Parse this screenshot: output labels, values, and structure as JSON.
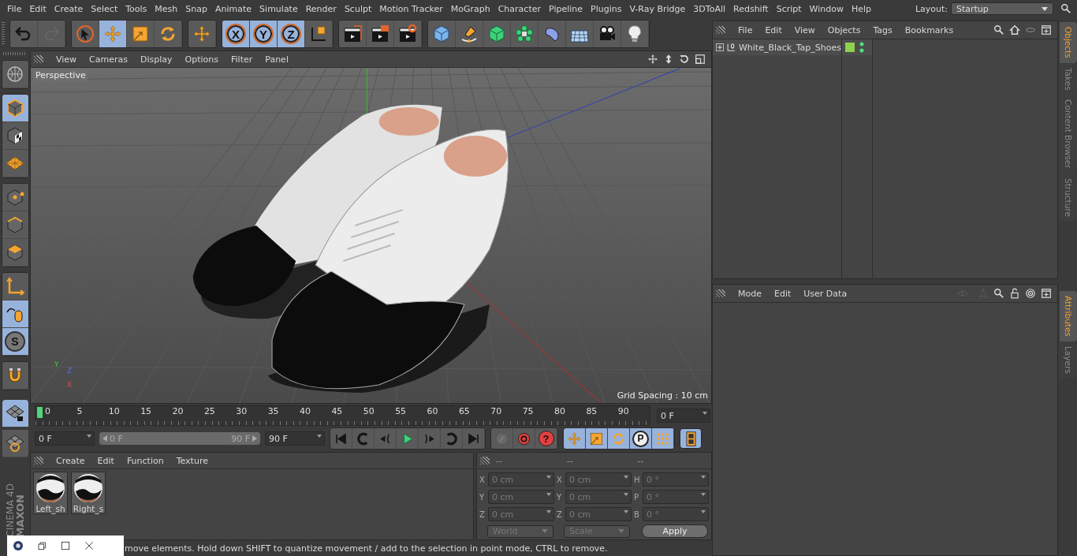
{
  "menu": [
    "File",
    "Edit",
    "Create",
    "Select",
    "Tools",
    "Mesh",
    "Snap",
    "Animate",
    "Simulate",
    "Render",
    "Sculpt",
    "Motion Tracker",
    "MoGraph",
    "Character",
    "Pipeline",
    "Plugins",
    "V-Ray Bridge",
    "3DToAll",
    "Redshift",
    "Script",
    "Window",
    "Help"
  ],
  "layout": {
    "label": "Layout:",
    "value": "Startup"
  },
  "toolbar": [
    {
      "buttons": [
        {
          "kind": "undo",
          "selected": false,
          "disabled": false
        },
        {
          "kind": "redo",
          "selected": false,
          "disabled": true
        }
      ]
    },
    {
      "buttons": [
        {
          "kind": "select",
          "selected": false,
          "disabled": false
        },
        {
          "kind": "move",
          "selected": true,
          "disabled": false
        },
        {
          "kind": "scale",
          "selected": false,
          "disabled": false
        },
        {
          "kind": "rotate",
          "selected": false,
          "disabled": false
        }
      ]
    },
    {
      "buttons": [
        {
          "kind": "move",
          "selected": false,
          "disabled": false
        }
      ]
    },
    {
      "buttons": [
        {
          "kind": "axis",
          "label": "X",
          "selected": true,
          "disabled": false
        },
        {
          "kind": "axis",
          "label": "Y",
          "selected": true,
          "disabled": false
        },
        {
          "kind": "axis",
          "label": "Z",
          "selected": true,
          "disabled": false
        },
        {
          "kind": "coords",
          "selected": false,
          "disabled": false
        }
      ]
    },
    {
      "buttons": [
        {
          "kind": "render-view",
          "selected": false,
          "disabled": false
        },
        {
          "kind": "render-pic",
          "selected": false,
          "disabled": false
        },
        {
          "kind": "render-settings",
          "selected": false,
          "disabled": false
        }
      ]
    },
    {
      "buttons": [
        {
          "kind": "cube",
          "selected": false,
          "disabled": false
        },
        {
          "kind": "pen",
          "selected": false,
          "disabled": false
        },
        {
          "kind": "subdiv",
          "selected": false,
          "disabled": false
        },
        {
          "kind": "cloner",
          "selected": false,
          "disabled": false
        },
        {
          "kind": "deformer",
          "selected": false,
          "disabled": false
        },
        {
          "kind": "floor",
          "selected": false,
          "disabled": false
        },
        {
          "kind": "camera",
          "selected": false,
          "disabled": false
        },
        {
          "kind": "light",
          "selected": false,
          "disabled": false
        }
      ]
    }
  ],
  "left_tools": [
    {
      "buttons": [
        {
          "kind": "globe",
          "selected": false
        }
      ]
    },
    {
      "buttons": [
        {
          "kind": "model",
          "selected": true
        },
        {
          "kind": "texture",
          "selected": false
        },
        {
          "kind": "workplane",
          "selected": false
        }
      ]
    },
    {
      "buttons": [
        {
          "kind": "points",
          "selected": false
        },
        {
          "kind": "edges",
          "selected": false
        },
        {
          "kind": "polygons",
          "selected": false
        }
      ]
    },
    {
      "buttons": [
        {
          "kind": "axis-tool",
          "selected": false
        },
        {
          "kind": "tweak",
          "selected": true
        },
        {
          "kind": "solo",
          "label": "S",
          "selected": true
        }
      ]
    },
    {
      "buttons": [
        {
          "kind": "magnet",
          "selected": false
        }
      ]
    },
    {
      "buttons": [
        {
          "kind": "tl-lock",
          "selected": true
        },
        {
          "kind": "tl-rotate",
          "selected": false
        }
      ]
    }
  ],
  "logo": {
    "brand": "MAXON",
    "product": "CINEMA 4D"
  },
  "viewport": {
    "menu": [
      "View",
      "Cameras",
      "Display",
      "Options",
      "Filter",
      "Panel"
    ],
    "camera": "Perspective",
    "grid_spacing": "Grid Spacing : 10 cm",
    "axes": [
      "Y",
      "Z",
      "X"
    ]
  },
  "timeline": {
    "ticks": [
      "0",
      "5",
      "10",
      "15",
      "20",
      "25",
      "30",
      "35",
      "40",
      "45",
      "50",
      "55",
      "60",
      "65",
      "70",
      "75",
      "80",
      "85",
      "90"
    ],
    "playhead": {
      "level": 0
    },
    "current": "0 F"
  },
  "controls": {
    "start": "0 F",
    "range": {
      "level": 1
    },
    "range_start": "0 F",
    "range_end": "90 F",
    "end": "90 F",
    "transport": [
      {
        "kind": "first"
      },
      {
        "kind": "prev-key"
      },
      {
        "kind": "prev-frame"
      },
      {
        "kind": "play"
      },
      {
        "kind": "next-frame"
      },
      {
        "kind": "next-key"
      },
      {
        "kind": "last"
      }
    ],
    "record": [
      {
        "kind": "record-motion",
        "disabled": true
      },
      {
        "kind": "autokey",
        "disabled": false
      },
      {
        "kind": "key-help",
        "label": "?",
        "disabled": false
      }
    ],
    "keys": [
      {
        "kind": "move",
        "selected": true
      },
      {
        "kind": "scale",
        "selected": true
      },
      {
        "kind": "rotate",
        "selected": true
      },
      {
        "kind": "param",
        "label": "P",
        "selected": true
      },
      {
        "kind": "pla",
        "selected": true
      }
    ],
    "timeline_button": {
      "selected": true
    }
  },
  "materials": {
    "menu": [
      "Create",
      "Edit",
      "Function",
      "Texture"
    ],
    "items": [
      {
        "name": "Left_sh"
      },
      {
        "name": "Right_s"
      }
    ]
  },
  "coordinates": {
    "headers": [
      "--",
      "--",
      "--"
    ],
    "rows": [
      {
        "a": "X",
        "pos": "0 cm",
        "b": "X",
        "size": "0 cm",
        "c": "H",
        "rot": "0 °"
      },
      {
        "a": "Y",
        "pos": "0 cm",
        "b": "Y",
        "size": "0 cm",
        "c": "P",
        "rot": "0 °"
      },
      {
        "a": "Z",
        "pos": "0 cm",
        "b": "Z",
        "size": "0 cm",
        "c": "B",
        "rot": "0 °"
      }
    ],
    "mode": "World",
    "apply_mode": "Scale",
    "apply": "Apply"
  },
  "status_bar": "move elements. Hold down SHIFT to quantize movement / add to the selection in point mode, CTRL to remove.",
  "object_manager": {
    "menu": [
      "File",
      "Edit",
      "View",
      "Objects",
      "Tags",
      "Bookmarks"
    ],
    "objects": [
      {
        "name": "White_Black_Tap_Shoes",
        "expanded": false
      }
    ]
  },
  "attributes": {
    "menu": [
      "Mode",
      "Edit",
      "User Data"
    ]
  },
  "side_tabs_top": [
    {
      "label": "Objects",
      "selected": true
    },
    {
      "label": "Takes",
      "selected": false
    },
    {
      "label": "Content Browser",
      "selected": false
    },
    {
      "label": "Structure",
      "selected": false
    }
  ],
  "side_tabs_bottom": [
    {
      "label": "Attributes",
      "selected": true
    },
    {
      "label": "Layers",
      "selected": false
    }
  ]
}
